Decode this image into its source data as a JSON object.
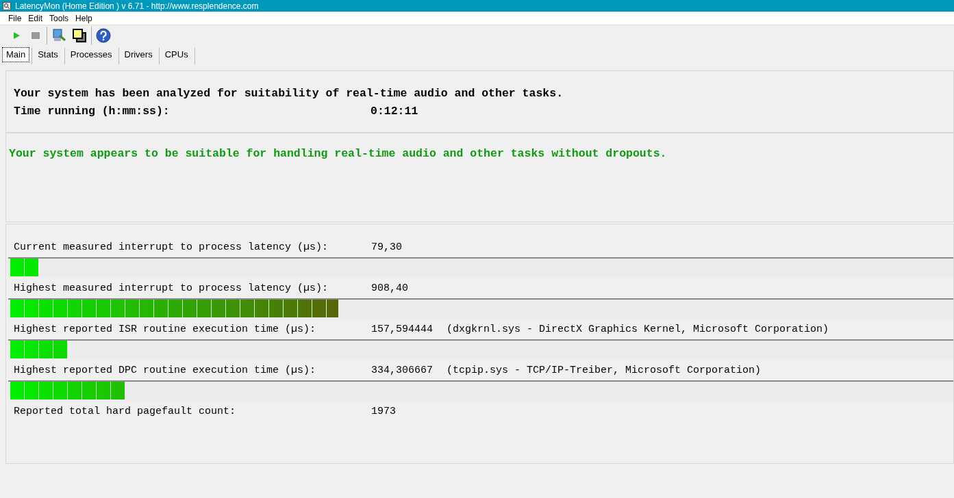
{
  "window": {
    "title": "LatencyMon  (Home Edition )  v 6.71 - http://www.resplendence.com"
  },
  "menu": [
    "File",
    "Edit",
    "Tools",
    "Help"
  ],
  "tabs": [
    {
      "label": "Main",
      "selected": true
    },
    {
      "label": "Stats",
      "selected": false
    },
    {
      "label": "Processes",
      "selected": false
    },
    {
      "label": "Drivers",
      "selected": false
    },
    {
      "label": "CPUs",
      "selected": false
    }
  ],
  "summary": {
    "line": "Your system has been analyzed for suitability of real-time audio and other tasks.",
    "time_label": "Time running (h:mm:ss):",
    "time_value": "0:12:11"
  },
  "verdict": "Your system appears to be suitable for handling real-time audio and other tasks without dropouts.",
  "metrics": [
    {
      "label": "Current measured interrupt to process latency (µs):",
      "value": "79,30",
      "level": 0.03
    },
    {
      "label": "Highest measured interrupt to process latency (µs):",
      "value": "908,40",
      "level": 0.348
    },
    {
      "label": "Highest reported ISR routine execution time (µs):",
      "value": "157,594444",
      "detail": "(dxgkrnl.sys - DirectX Graphics Kernel, Microsoft Corporation)",
      "level": 0.061
    },
    {
      "label": "Highest reported DPC routine execution time (µs):",
      "value": "334,306667",
      "detail": "(tcpip.sys - TCP/IP-Treiber, Microsoft Corporation)",
      "level": 0.121
    },
    {
      "label": "Reported total hard pagefault count:",
      "value": "1973"
    }
  ]
}
